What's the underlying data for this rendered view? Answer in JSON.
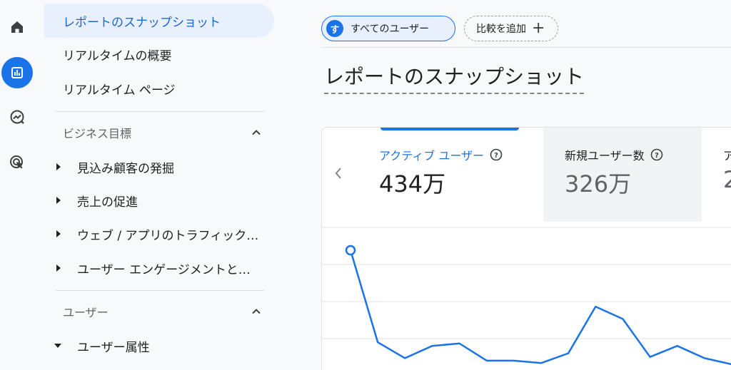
{
  "rail": {
    "items": [
      {
        "icon": "home-icon",
        "active": false
      },
      {
        "icon": "reports-bar-chart-icon",
        "active": true
      },
      {
        "icon": "explore-trend-icon",
        "active": false
      },
      {
        "icon": "advertising-target-icon",
        "active": false
      }
    ]
  },
  "nav": {
    "items": [
      {
        "label": "レポートのスナップショット",
        "active": true
      },
      {
        "label": "リアルタイムの概要"
      },
      {
        "label": "リアルタイム ページ"
      }
    ],
    "sections": [
      {
        "label": "ビジネス目標",
        "items": [
          {
            "label": "見込み顧客の発掘"
          },
          {
            "label": "売上の促進"
          },
          {
            "label": "ウェブ / アプリのトラフィック…"
          },
          {
            "label": "ユーザー エンゲージメントと…"
          }
        ]
      },
      {
        "label": "ユーザー",
        "items": [
          {
            "label": "ユーザー属性"
          }
        ]
      }
    ]
  },
  "main": {
    "user_chip": {
      "avatar_letter": "す",
      "label": "すべてのユーザー"
    },
    "compare_chip": {
      "label": "比較を追加",
      "plus": "+"
    },
    "page_title": "レポートのスナップショット",
    "metrics": [
      {
        "label": "アクティブ ユーザー",
        "value": "434万",
        "selected": true
      },
      {
        "label": "新規ユーザー数",
        "value": "326万"
      },
      {
        "label": "ア",
        "value": "2"
      }
    ]
  },
  "colors": {
    "accent": "#1a73e8",
    "selected_bg": "#e8f0fe",
    "line": "#1a73e8"
  },
  "chart_data": {
    "type": "line",
    "series": [
      {
        "values": [
          100,
          25,
          12,
          22,
          24,
          10,
          10,
          8,
          16,
          54,
          44,
          13,
          22,
          12,
          7
        ]
      }
    ],
    "grid": true
  }
}
